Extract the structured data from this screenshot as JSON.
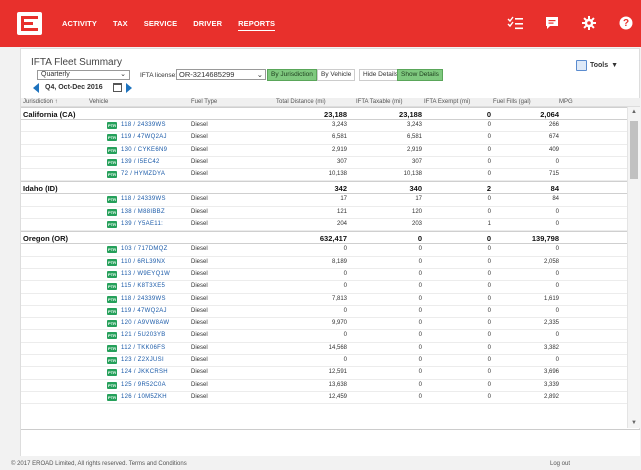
{
  "nav": {
    "items": [
      {
        "label": "ACTIVITY",
        "active": false
      },
      {
        "label": "TAX",
        "active": false
      },
      {
        "label": "SERVICE",
        "active": false
      },
      {
        "label": "DRIVER",
        "active": false
      },
      {
        "label": "REPORTS",
        "active": true
      }
    ],
    "icons": [
      "list-check-icon",
      "chat-icon",
      "gear-icon",
      "help-icon"
    ],
    "help_glyph": "?"
  },
  "report": {
    "title": "IFTA Fleet Summary",
    "period_select": "Quarterly",
    "period_label": "Q4, Oct-Dec 2016",
    "license_label": "IFTA license:",
    "license_value": "OR-3214685299",
    "buttons": [
      {
        "label": "By Jurisdiction",
        "on": true
      },
      {
        "label": "By Vehicle",
        "on": false
      },
      {
        "label": "Hide Details",
        "on": false
      },
      {
        "label": "Show Details",
        "on": true
      }
    ],
    "tools_label": "Tools"
  },
  "table": {
    "columns": [
      "Jurisdiction ↑",
      "Vehicle",
      "Fuel Type",
      "Total Distance (mi)",
      "IFTA Taxable (mi)",
      "IFTA Exempt (mi)",
      "Fuel Fills (gal)",
      "MPG"
    ],
    "badge": "PTR",
    "rows": [
      {
        "type": "group",
        "name": "California (CA)",
        "total": "23,188",
        "taxable": "23,188",
        "exempt": "0",
        "fuel": "2,064"
      },
      {
        "type": "row",
        "vehicle": "118 / 24339WS",
        "fuel_type": "Diesel",
        "total": "3,243",
        "taxable": "3,243",
        "exempt": "0",
        "fuel": "266"
      },
      {
        "type": "row",
        "vehicle": "119 / 47WQ2AJ",
        "fuel_type": "Diesel",
        "total": "6,581",
        "taxable": "6,581",
        "exempt": "0",
        "fuel": "674"
      },
      {
        "type": "row",
        "vehicle": "130 / CYKE6N9",
        "fuel_type": "Diesel",
        "total": "2,919",
        "taxable": "2,919",
        "exempt": "0",
        "fuel": "409"
      },
      {
        "type": "row",
        "vehicle": "139 / I5EC42",
        "fuel_type": "Diesel",
        "total": "307",
        "taxable": "307",
        "exempt": "0",
        "fuel": "0"
      },
      {
        "type": "row",
        "vehicle": "72 / HYMZDYA",
        "fuel_type": "Diesel",
        "total": "10,138",
        "taxable": "10,138",
        "exempt": "0",
        "fuel": "715"
      },
      {
        "type": "group",
        "name": "Idaho (ID)",
        "total": "342",
        "taxable": "340",
        "exempt": "2",
        "fuel": "84"
      },
      {
        "type": "row",
        "vehicle": "118 / 24339WS",
        "fuel_type": "Diesel",
        "total": "17",
        "taxable": "17",
        "exempt": "0",
        "fuel": "84"
      },
      {
        "type": "row",
        "vehicle": "138 / M88IBBZ",
        "fuel_type": "Diesel",
        "total": "121",
        "taxable": "120",
        "exempt": "0",
        "fuel": "0"
      },
      {
        "type": "row",
        "vehicle": "139 / Y5AE11:",
        "fuel_type": "Diesel",
        "total": "204",
        "taxable": "203",
        "exempt": "1",
        "fuel": "0"
      },
      {
        "type": "group",
        "name": "Oregon (OR)",
        "total": "632,417",
        "taxable": "0",
        "exempt": "0",
        "fuel": "139,798"
      },
      {
        "type": "row",
        "vehicle": "103 / 717DMQZ",
        "fuel_type": "Diesel",
        "total": "0",
        "taxable": "0",
        "exempt": "0",
        "fuel": "0"
      },
      {
        "type": "row",
        "vehicle": "110 / 6RL39NX",
        "fuel_type": "Diesel",
        "total": "8,189",
        "taxable": "0",
        "exempt": "0",
        "fuel": "2,058"
      },
      {
        "type": "row",
        "vehicle": "113 / W9EYQ1W",
        "fuel_type": "Diesel",
        "total": "0",
        "taxable": "0",
        "exempt": "0",
        "fuel": "0"
      },
      {
        "type": "row",
        "vehicle": "115 / K8T3XE5",
        "fuel_type": "Diesel",
        "total": "0",
        "taxable": "0",
        "exempt": "0",
        "fuel": "0"
      },
      {
        "type": "row",
        "vehicle": "118 / 24339WS",
        "fuel_type": "Diesel",
        "total": "7,813",
        "taxable": "0",
        "exempt": "0",
        "fuel": "1,619"
      },
      {
        "type": "row",
        "vehicle": "119 / 47WQ2AJ",
        "fuel_type": "Diesel",
        "total": "0",
        "taxable": "0",
        "exempt": "0",
        "fuel": "0"
      },
      {
        "type": "row",
        "vehicle": "120 / A9VW8AW",
        "fuel_type": "Diesel",
        "total": "9,970",
        "taxable": "0",
        "exempt": "0",
        "fuel": "2,335"
      },
      {
        "type": "row",
        "vehicle": "121 / 5U203YB",
        "fuel_type": "Diesel",
        "total": "0",
        "taxable": "0",
        "exempt": "0",
        "fuel": "0"
      },
      {
        "type": "row",
        "vehicle": "112 / TKK06FS",
        "fuel_type": "Diesel",
        "total": "14,568",
        "taxable": "0",
        "exempt": "0",
        "fuel": "3,382"
      },
      {
        "type": "row",
        "vehicle": "123 / Z2XJUSI",
        "fuel_type": "Diesel",
        "total": "0",
        "taxable": "0",
        "exempt": "0",
        "fuel": "0"
      },
      {
        "type": "row",
        "vehicle": "124 / JKKCRSH",
        "fuel_type": "Diesel",
        "total": "12,591",
        "taxable": "0",
        "exempt": "0",
        "fuel": "3,696"
      },
      {
        "type": "row",
        "vehicle": "125 / 9R52C0A",
        "fuel_type": "Diesel",
        "total": "13,638",
        "taxable": "0",
        "exempt": "0",
        "fuel": "3,339"
      },
      {
        "type": "row",
        "vehicle": "126 / 10M5ZKH",
        "fuel_type": "Diesel",
        "total": "12,459",
        "taxable": "0",
        "exempt": "0",
        "fuel": "2,892"
      }
    ]
  },
  "footer": {
    "copyright": "© 2017 EROAD Limited, All rights reserved.  Terms and Conditions",
    "logout": "Log out"
  },
  "colors": {
    "brand": "#e8302c",
    "link": "#1a5aa8",
    "badge": "#25a05a",
    "toggle_on": "#7fc97f"
  }
}
